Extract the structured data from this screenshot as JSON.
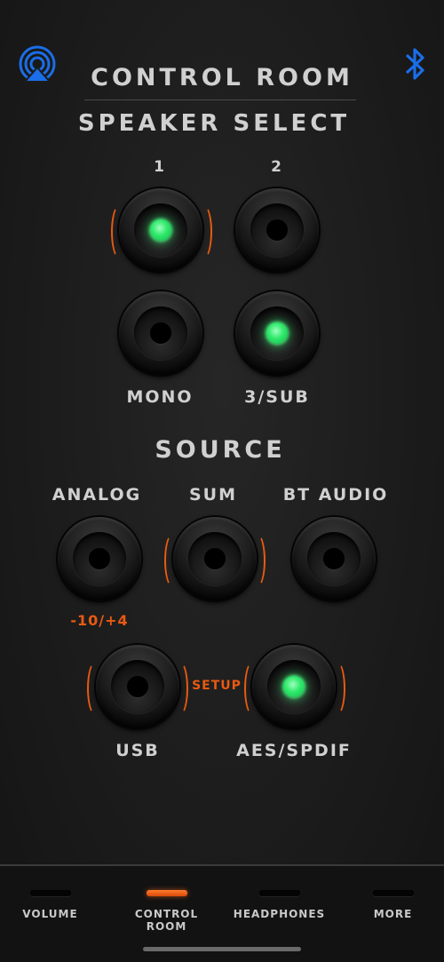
{
  "header": {
    "title": "CONTROL ROOM",
    "airplay_icon": "airplay-icon",
    "bluetooth_icon": "bluetooth-icon"
  },
  "speaker_select": {
    "heading": "SPEAKER SELECT",
    "buttons": [
      {
        "label": "1",
        "active": true,
        "selected_bracket": true
      },
      {
        "label": "2",
        "active": false,
        "selected_bracket": false
      },
      {
        "label": "MONO",
        "active": false,
        "selected_bracket": false
      },
      {
        "label": "3/SUB",
        "active": true,
        "selected_bracket": false
      }
    ]
  },
  "source": {
    "heading": "SOURCE",
    "buttons": [
      {
        "label": "ANALOG",
        "active": false,
        "selected_bracket": false
      },
      {
        "label": "SUM",
        "active": false,
        "selected_bracket": true
      },
      {
        "label": "BT AUDIO",
        "active": false,
        "selected_bracket": false
      },
      {
        "label": "USB",
        "active": false,
        "selected_bracket": true
      },
      {
        "label": "AES/SPDIF",
        "active": true,
        "selected_bracket": true
      }
    ],
    "analog_level": "-10/+4",
    "setup_label": "SETUP"
  },
  "tabs": [
    {
      "label": "VOLUME",
      "active": false
    },
    {
      "label": "CONTROL\nROOM",
      "active": true
    },
    {
      "label": "HEADPHONES",
      "active": false
    },
    {
      "label": "MORE",
      "active": false
    }
  ],
  "colors": {
    "accent": "#e85a12",
    "led_green": "#2ee86a",
    "icon_blue": "#1a6ee8"
  }
}
